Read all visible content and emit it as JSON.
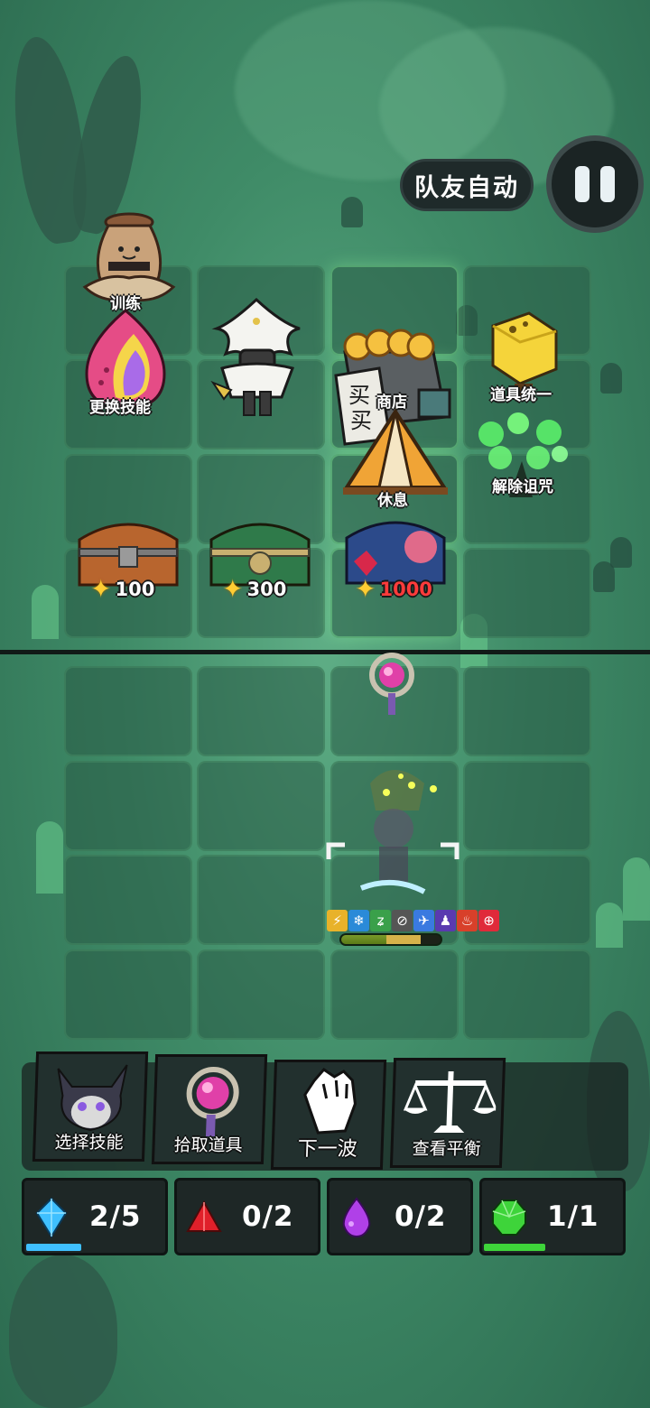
{
  "hud": {
    "auto_label": "队友自动",
    "pause_icon": "pause-icon"
  },
  "board": {
    "labels": {
      "train": "训练",
      "change_skill": "更换技能",
      "shop": "商店",
      "rest": "休息",
      "item_unify": "道具统一",
      "remove_curse": "解除诅咒"
    },
    "chests": [
      {
        "price": "100",
        "price_color": "#ffffff"
      },
      {
        "price": "300",
        "price_color": "#ffffff"
      },
      {
        "price": "1000",
        "price_color": "#ff3b3b"
      }
    ],
    "currency_icon": "star-icon"
  },
  "hero": {
    "buffs": [
      "⚡",
      "❄",
      "ʑ",
      "⊘",
      "✈",
      "♟",
      "♨",
      "⊕"
    ],
    "hp_fraction": 0.45,
    "shield_fraction": 0.35
  },
  "actions": [
    {
      "label": "选择技能",
      "icon": "cat-character-icon"
    },
    {
      "label": "拾取道具",
      "icon": "staff-orb-icon"
    },
    {
      "label": "下一波",
      "icon": "raised-fist-icon"
    },
    {
      "label": "查看平衡",
      "icon": "balance-scale-icon"
    }
  ],
  "gems": [
    {
      "value": "2/5",
      "color": "#3fc0ff",
      "icon": "blue-crystal-icon",
      "fill": 0.4
    },
    {
      "value": "0/2",
      "color": "#e0202a",
      "icon": "red-gem-icon",
      "fill": 0
    },
    {
      "value": "0/2",
      "color": "#b040e8",
      "icon": "purple-gem-icon",
      "fill": 0
    },
    {
      "value": "1/1",
      "color": "#3ed43a",
      "icon": "green-gem-icon",
      "fill": 0.45
    }
  ]
}
